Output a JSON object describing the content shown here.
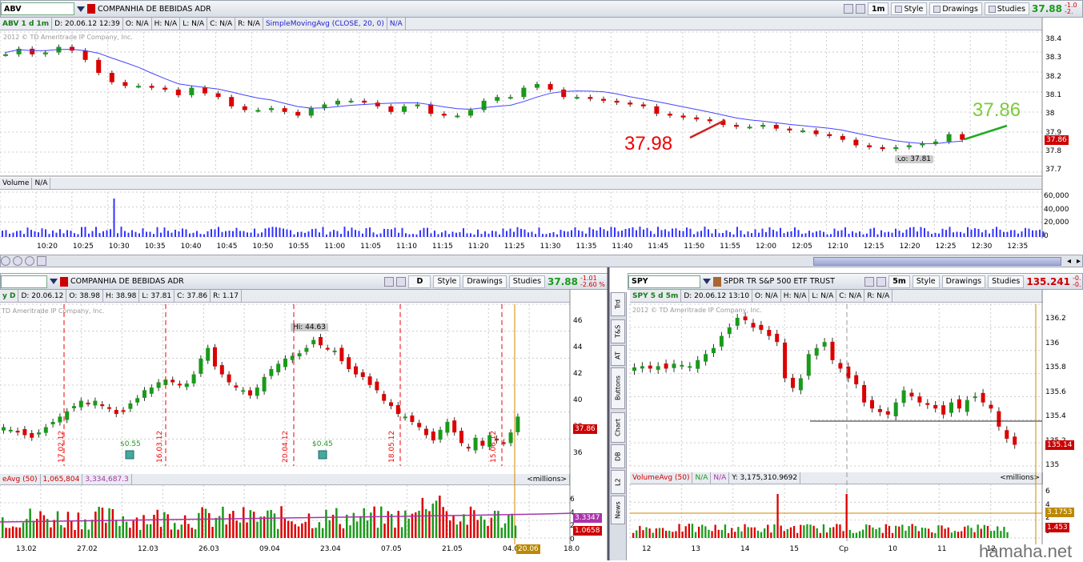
{
  "top": {
    "symbol": "ABV",
    "name": "COMPANHIA DE BEBIDAS ADR",
    "period_btn": "1m",
    "style": "Style",
    "drawings": "Drawings",
    "studies": "Studies",
    "price": "37.88",
    "chg1": "-1.0",
    "chg2": "-2.",
    "study_title": "ABV 1 d 1m",
    "date": "D: 20.06.12 12:39",
    "o": "O: N/A",
    "h": "H: N/A",
    "l": "L: N/A",
    "c": "C: N/A",
    "r": "R: N/A",
    "sma": "SimpleMovingAvg (CLOSE, 20, 0)",
    "sma_val": "N/A",
    "copyright": "2012 © TD Ameritrade IP Company, Inc.",
    "ann_red": "37.98",
    "ann_green": "37.86",
    "lo": "Lo: 37.81",
    "last": "37.86",
    "yticks": [
      "38.4",
      "38.3",
      "38.2",
      "38.1",
      "38",
      "37.9",
      "37.8",
      "37.7"
    ],
    "volume_label": "Volume",
    "volume_val": "N/A",
    "vticks": [
      "60,000",
      "40,000",
      "20,000",
      "0"
    ],
    "xticks": [
      "10:20",
      "10:25",
      "10:30",
      "10:35",
      "10:40",
      "10:45",
      "10:50",
      "10:55",
      "11:00",
      "11:05",
      "11:10",
      "11:15",
      "11:20",
      "11:25",
      "11:30",
      "11:35",
      "11:40",
      "11:45",
      "11:50",
      "11:55",
      "12:00",
      "12:05",
      "12:10",
      "12:15",
      "12:20",
      "12:25",
      "12:30",
      "12:35"
    ]
  },
  "left": {
    "name": "COMPANHIA DE BEBIDAS ADR",
    "period_btn": "D",
    "style": "Style",
    "drawings": "Drawings",
    "studies": "Studies",
    "price": "37.88",
    "chg1": "-1.01",
    "chg2": "-2.60 %",
    "title": "y D",
    "date": "D: 20.06.12",
    "o": "O: 38.98",
    "h": "H: 38.98",
    "l": "L: 37.81",
    "c": "C: 37.86",
    "r": "R: 1.17",
    "copyright": "TD Ameritrade IP Company, Inc.",
    "hi": "Hi: 44.63",
    "last": "37.86",
    "div1": "$0.55",
    "div2": "$0.45",
    "vlines": [
      "17.02.12",
      "16.03.12",
      "20.04.12",
      "18.05.12",
      "15.06.12"
    ],
    "yticks": [
      "46",
      "44",
      "42",
      "40",
      "38",
      "36"
    ],
    "vol_label": "eAvg (50)",
    "vol_val1": "1,065,804",
    "vol_val2": "3,334,687.3",
    "millions": "<millions>",
    "vol_badge1": "3.3347",
    "vol_badge2": "1.0658",
    "vticks": [
      "6",
      "4",
      "2",
      "0"
    ],
    "xticks": [
      "13.02",
      "27.02",
      "12.03",
      "26.03",
      "09.04",
      "23.04",
      "07.05",
      "21.05",
      "04.06",
      "18.0"
    ],
    "date_badge": "20.06"
  },
  "right": {
    "symbol": "SPY",
    "name": "SPDR TR S&P 500 ETF TRUST",
    "period_btn": "5m",
    "style": "Style",
    "drawings": "Drawings",
    "studies": "Studies",
    "price": "135.241",
    "chg1": "-0.",
    "chg2": "-0.",
    "title": "SPY 5 d 5m",
    "date": "D: 20.06.12 13:10",
    "o": "O: N/A",
    "h": "H: N/A",
    "l": "L: N/A",
    "c": "C: N/A",
    "r": "R: N/A",
    "copyright": "2012 © TD Ameritrade IP Company, Inc.",
    "last": "135.14",
    "yticks": [
      "136.2",
      "136",
      "135.8",
      "135.6",
      "135.4",
      "135.2",
      "135"
    ],
    "vol_label": "VolumeAvg (50)",
    "vol_val1": "N/A",
    "vol_val2": "N/A",
    "vol_y": "Y: 3,175,310.9692",
    "millions": "<millions>",
    "vol_badge1": "3.1753",
    "vol_badge2": "1.453",
    "vticks": [
      "6",
      "4",
      "2",
      "0"
    ],
    "xticks": [
      "12",
      "13",
      "14",
      "15",
      "Ср",
      "10",
      "11",
      "12"
    ]
  },
  "sidebar": [
    "Trd",
    "T&S",
    "AT",
    "Buttons",
    "Chart",
    "DB",
    "L2",
    "News"
  ],
  "watermark": "hamaha.net"
}
